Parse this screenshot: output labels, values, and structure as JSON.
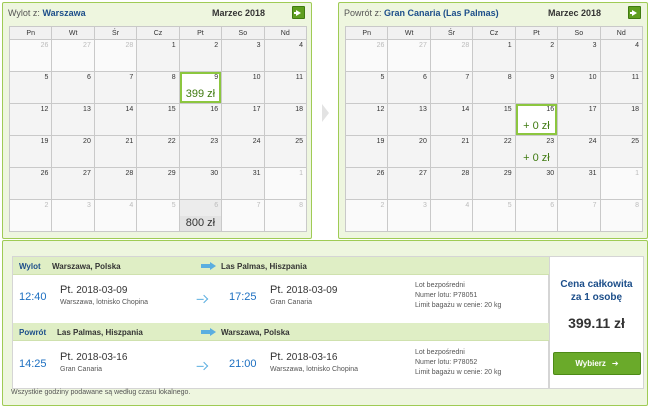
{
  "outbound_calendar": {
    "label_prefix": "Wylot z:",
    "city": "Warszawa",
    "month": "Marzec 2018",
    "weekdays": [
      "Pn",
      "Wt",
      "Śr",
      "Cz",
      "Pt",
      "So",
      "Nd"
    ],
    "weeks": [
      [
        {
          "d": "26",
          "o": true
        },
        {
          "d": "27",
          "o": true
        },
        {
          "d": "28",
          "o": true
        },
        {
          "d": "1"
        },
        {
          "d": "2"
        },
        {
          "d": "3"
        },
        {
          "d": "4"
        }
      ],
      [
        {
          "d": "5"
        },
        {
          "d": "6"
        },
        {
          "d": "7"
        },
        {
          "d": "8"
        },
        {
          "d": "9",
          "price": "399 zł",
          "sel": true
        },
        {
          "d": "10"
        },
        {
          "d": "11"
        }
      ],
      [
        {
          "d": "12"
        },
        {
          "d": "13"
        },
        {
          "d": "14"
        },
        {
          "d": "15"
        },
        {
          "d": "16"
        },
        {
          "d": "17"
        },
        {
          "d": "18"
        }
      ],
      [
        {
          "d": "19"
        },
        {
          "d": "20"
        },
        {
          "d": "21"
        },
        {
          "d": "22"
        },
        {
          "d": "23"
        },
        {
          "d": "24"
        },
        {
          "d": "25"
        }
      ],
      [
        {
          "d": "26"
        },
        {
          "d": "27"
        },
        {
          "d": "28"
        },
        {
          "d": "29"
        },
        {
          "d": "30"
        },
        {
          "d": "31"
        },
        {
          "d": "1",
          "o": true
        }
      ],
      [
        {
          "d": "2",
          "o": true
        },
        {
          "d": "3",
          "o": true
        },
        {
          "d": "4",
          "o": true
        },
        {
          "d": "5",
          "o": true
        },
        {
          "d": "6",
          "o": true,
          "price": "800 zł",
          "shade": true
        },
        {
          "d": "7",
          "o": true
        },
        {
          "d": "8",
          "o": true
        }
      ]
    ]
  },
  "return_calendar": {
    "label_prefix": "Powrót z:",
    "city": "Gran Canaria (Las Palmas)",
    "month": "Marzec 2018",
    "weekdays": [
      "Pn",
      "Wt",
      "Śr",
      "Cz",
      "Pt",
      "So",
      "Nd"
    ],
    "weeks": [
      [
        {
          "d": "26",
          "o": true
        },
        {
          "d": "27",
          "o": true
        },
        {
          "d": "28",
          "o": true
        },
        {
          "d": "1"
        },
        {
          "d": "2"
        },
        {
          "d": "3"
        },
        {
          "d": "4"
        }
      ],
      [
        {
          "d": "5"
        },
        {
          "d": "6"
        },
        {
          "d": "7"
        },
        {
          "d": "8"
        },
        {
          "d": "9"
        },
        {
          "d": "10"
        },
        {
          "d": "11"
        }
      ],
      [
        {
          "d": "12"
        },
        {
          "d": "13"
        },
        {
          "d": "14"
        },
        {
          "d": "15"
        },
        {
          "d": "16",
          "price": "+ 0 zł",
          "sel": true
        },
        {
          "d": "17"
        },
        {
          "d": "18"
        }
      ],
      [
        {
          "d": "19"
        },
        {
          "d": "20"
        },
        {
          "d": "21"
        },
        {
          "d": "22"
        },
        {
          "d": "23",
          "price": "+ 0 zł"
        },
        {
          "d": "24"
        },
        {
          "d": "25"
        }
      ],
      [
        {
          "d": "26"
        },
        {
          "d": "27"
        },
        {
          "d": "28"
        },
        {
          "d": "29"
        },
        {
          "d": "30"
        },
        {
          "d": "31"
        },
        {
          "d": "1",
          "o": true
        }
      ],
      [
        {
          "d": "2",
          "o": true
        },
        {
          "d": "3",
          "o": true
        },
        {
          "d": "4",
          "o": true
        },
        {
          "d": "5",
          "o": true
        },
        {
          "d": "6",
          "o": true
        },
        {
          "d": "7",
          "o": true
        },
        {
          "d": "8",
          "o": true
        }
      ]
    ]
  },
  "outbound_leg": {
    "kind": "Wylot",
    "from": "Warszawa, Polska",
    "to": "Las Palmas, Hiszpania",
    "dep_time": "12:40",
    "dep_day": "Pt.",
    "dep_date": "2018-03-09",
    "dep_airport": "Warszawa, lotnisko Chopina",
    "arr_time": "17:25",
    "arr_day": "Pt.",
    "arr_date": "2018-03-09",
    "arr_airport": "Gran Canaria",
    "flight_type": "Lot bezpośredni",
    "flight_number": "Numer lotu: P78051",
    "baggage": "Limit bagażu w cenie: 20 kg"
  },
  "return_leg": {
    "kind": "Powrót",
    "from": "Las Palmas, Hiszpania",
    "to": "Warszawa, Polska",
    "dep_time": "14:25",
    "dep_day": "Pt.",
    "dep_date": "2018-03-16",
    "dep_airport": "Gran Canaria",
    "arr_time": "21:00",
    "arr_day": "Pt.",
    "arr_date": "2018-03-16",
    "arr_airport": "Warszawa, lotnisko Chopina",
    "flight_type": "Lot bezpośredni",
    "flight_number": "Numer lotu: P78052",
    "baggage": "Limit bagażu w cenie: 20 kg"
  },
  "total": {
    "caption_line1": "Cena całkowita",
    "caption_line2": "za 1 osobę",
    "amount": "399.11 zł",
    "button_label": "Wybierz",
    "button_icon": "arrow-right-icon"
  },
  "footnote": "Wszystkie godziny podawane są według czasu lokalnego.",
  "colors": {
    "accent_green": "#8cc63f",
    "panel_bg": "#eef6df",
    "link_blue": "#1c4e8a",
    "time_blue": "#1c6fc1",
    "arrow_blue": "#5aaee0",
    "button_green": "#6aaa2a"
  }
}
